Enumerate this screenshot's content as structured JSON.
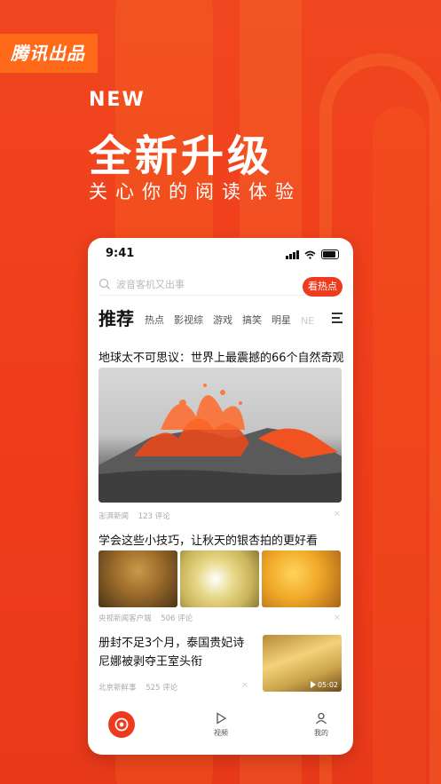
{
  "brand_tag": "腾讯出品",
  "hero": {
    "new_label": "NEW",
    "title": "全新升级",
    "subtitle": "关心你的阅读体验"
  },
  "status_bar": {
    "time": "9:41"
  },
  "search": {
    "placeholder": "波音客机又出事"
  },
  "hot_button": "看热点",
  "tabs": {
    "main": "推荐",
    "items": [
      "热点",
      "影视综",
      "游戏",
      "搞笑",
      "明星"
    ],
    "faded": "NE"
  },
  "news": [
    {
      "title": "地球太不可思议：世界上最震撼的66个自然奇观",
      "source": "澎湃新闻",
      "comments": "123 评论"
    },
    {
      "title": "学会这些小技巧，让秋天的银杏拍的更好看",
      "source": "央视新闻客户端",
      "comments": "506 评论"
    },
    {
      "title": "册封不足3个月，泰国贵妃诗尼娜被剥夺王室头衔",
      "source": "北京新鲜事",
      "comments": "525 评论",
      "duration": "05:02"
    }
  ],
  "close_symbol": "×",
  "bottom_nav": {
    "video": "视频",
    "mine": "我的"
  },
  "colors": {
    "accent": "#ef3b1d",
    "brand_tag_bg": "#ff6a1a"
  }
}
